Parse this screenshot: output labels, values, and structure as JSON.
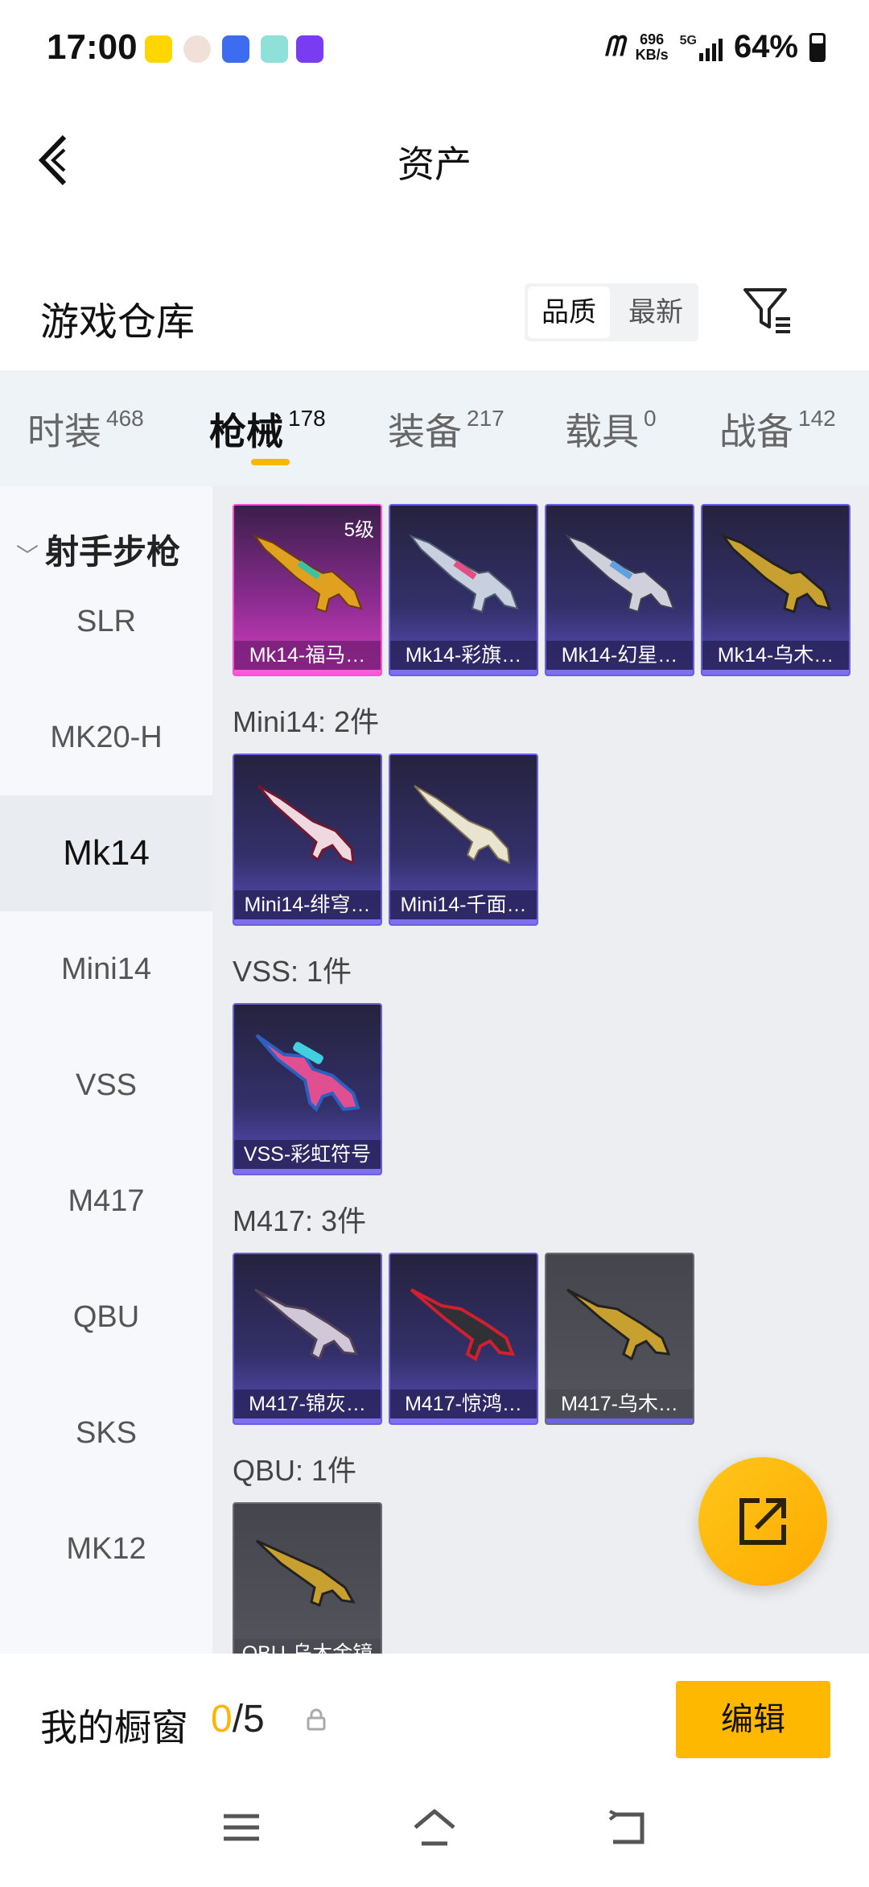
{
  "status_bar": {
    "time": "17:00",
    "net_speed_value": "696",
    "net_speed_unit": "KB/s",
    "network": "5G",
    "battery": "64%"
  },
  "header": {
    "title": "资产"
  },
  "warehouse": {
    "title": "游戏仓库",
    "sort_options": [
      "品质",
      "最新"
    ],
    "selected_sort": "品质"
  },
  "tabs": [
    {
      "label": "时装",
      "count": "468"
    },
    {
      "label": "枪械",
      "count": "178"
    },
    {
      "label": "装备",
      "count": "217"
    },
    {
      "label": "载具",
      "count": "0"
    },
    {
      "label": "战备",
      "count": "142"
    }
  ],
  "active_tab": "枪械",
  "sidebar": {
    "category": "射手步枪",
    "items": [
      "SLR",
      "MK20-H",
      "Mk14",
      "Mini14",
      "VSS",
      "M417",
      "QBU",
      "SKS",
      "MK12"
    ],
    "active": "Mk14"
  },
  "groups": [
    {
      "label": "",
      "cards": [
        {
          "name": "Mk14-福马…",
          "level": "5级",
          "rarity": "pink"
        },
        {
          "name": "Mk14-彩旗…",
          "rarity": "purple"
        },
        {
          "name": "Mk14-幻星…",
          "rarity": "purple"
        },
        {
          "name": "Mk14-乌木…",
          "rarity": "purple"
        }
      ]
    },
    {
      "label": "Mini14: 2件",
      "cards": [
        {
          "name": "Mini14-绯穹…",
          "rarity": "purple"
        },
        {
          "name": "Mini14-千面…",
          "rarity": "purple"
        }
      ]
    },
    {
      "label": "VSS: 1件",
      "cards": [
        {
          "name": "VSS-彩虹符号",
          "rarity": "purple"
        }
      ]
    },
    {
      "label": "M417: 3件",
      "cards": [
        {
          "name": "M417-锦灰…",
          "rarity": "purple"
        },
        {
          "name": "M417-惊鸿…",
          "rarity": "purple"
        },
        {
          "name": "M417-乌木…",
          "rarity": "gray"
        }
      ]
    },
    {
      "label": "QBU: 1件",
      "cards": [
        {
          "name": "QBU-乌木金镜",
          "rarity": "gray"
        }
      ]
    }
  ],
  "showcase": {
    "label": "我的橱窗",
    "current": "0",
    "total": "/5",
    "edit_label": "编辑"
  },
  "colors": {
    "accent": "#ffb400",
    "purple_rarity": "#6a5fe0",
    "pink_rarity": "#ff4fd6"
  }
}
